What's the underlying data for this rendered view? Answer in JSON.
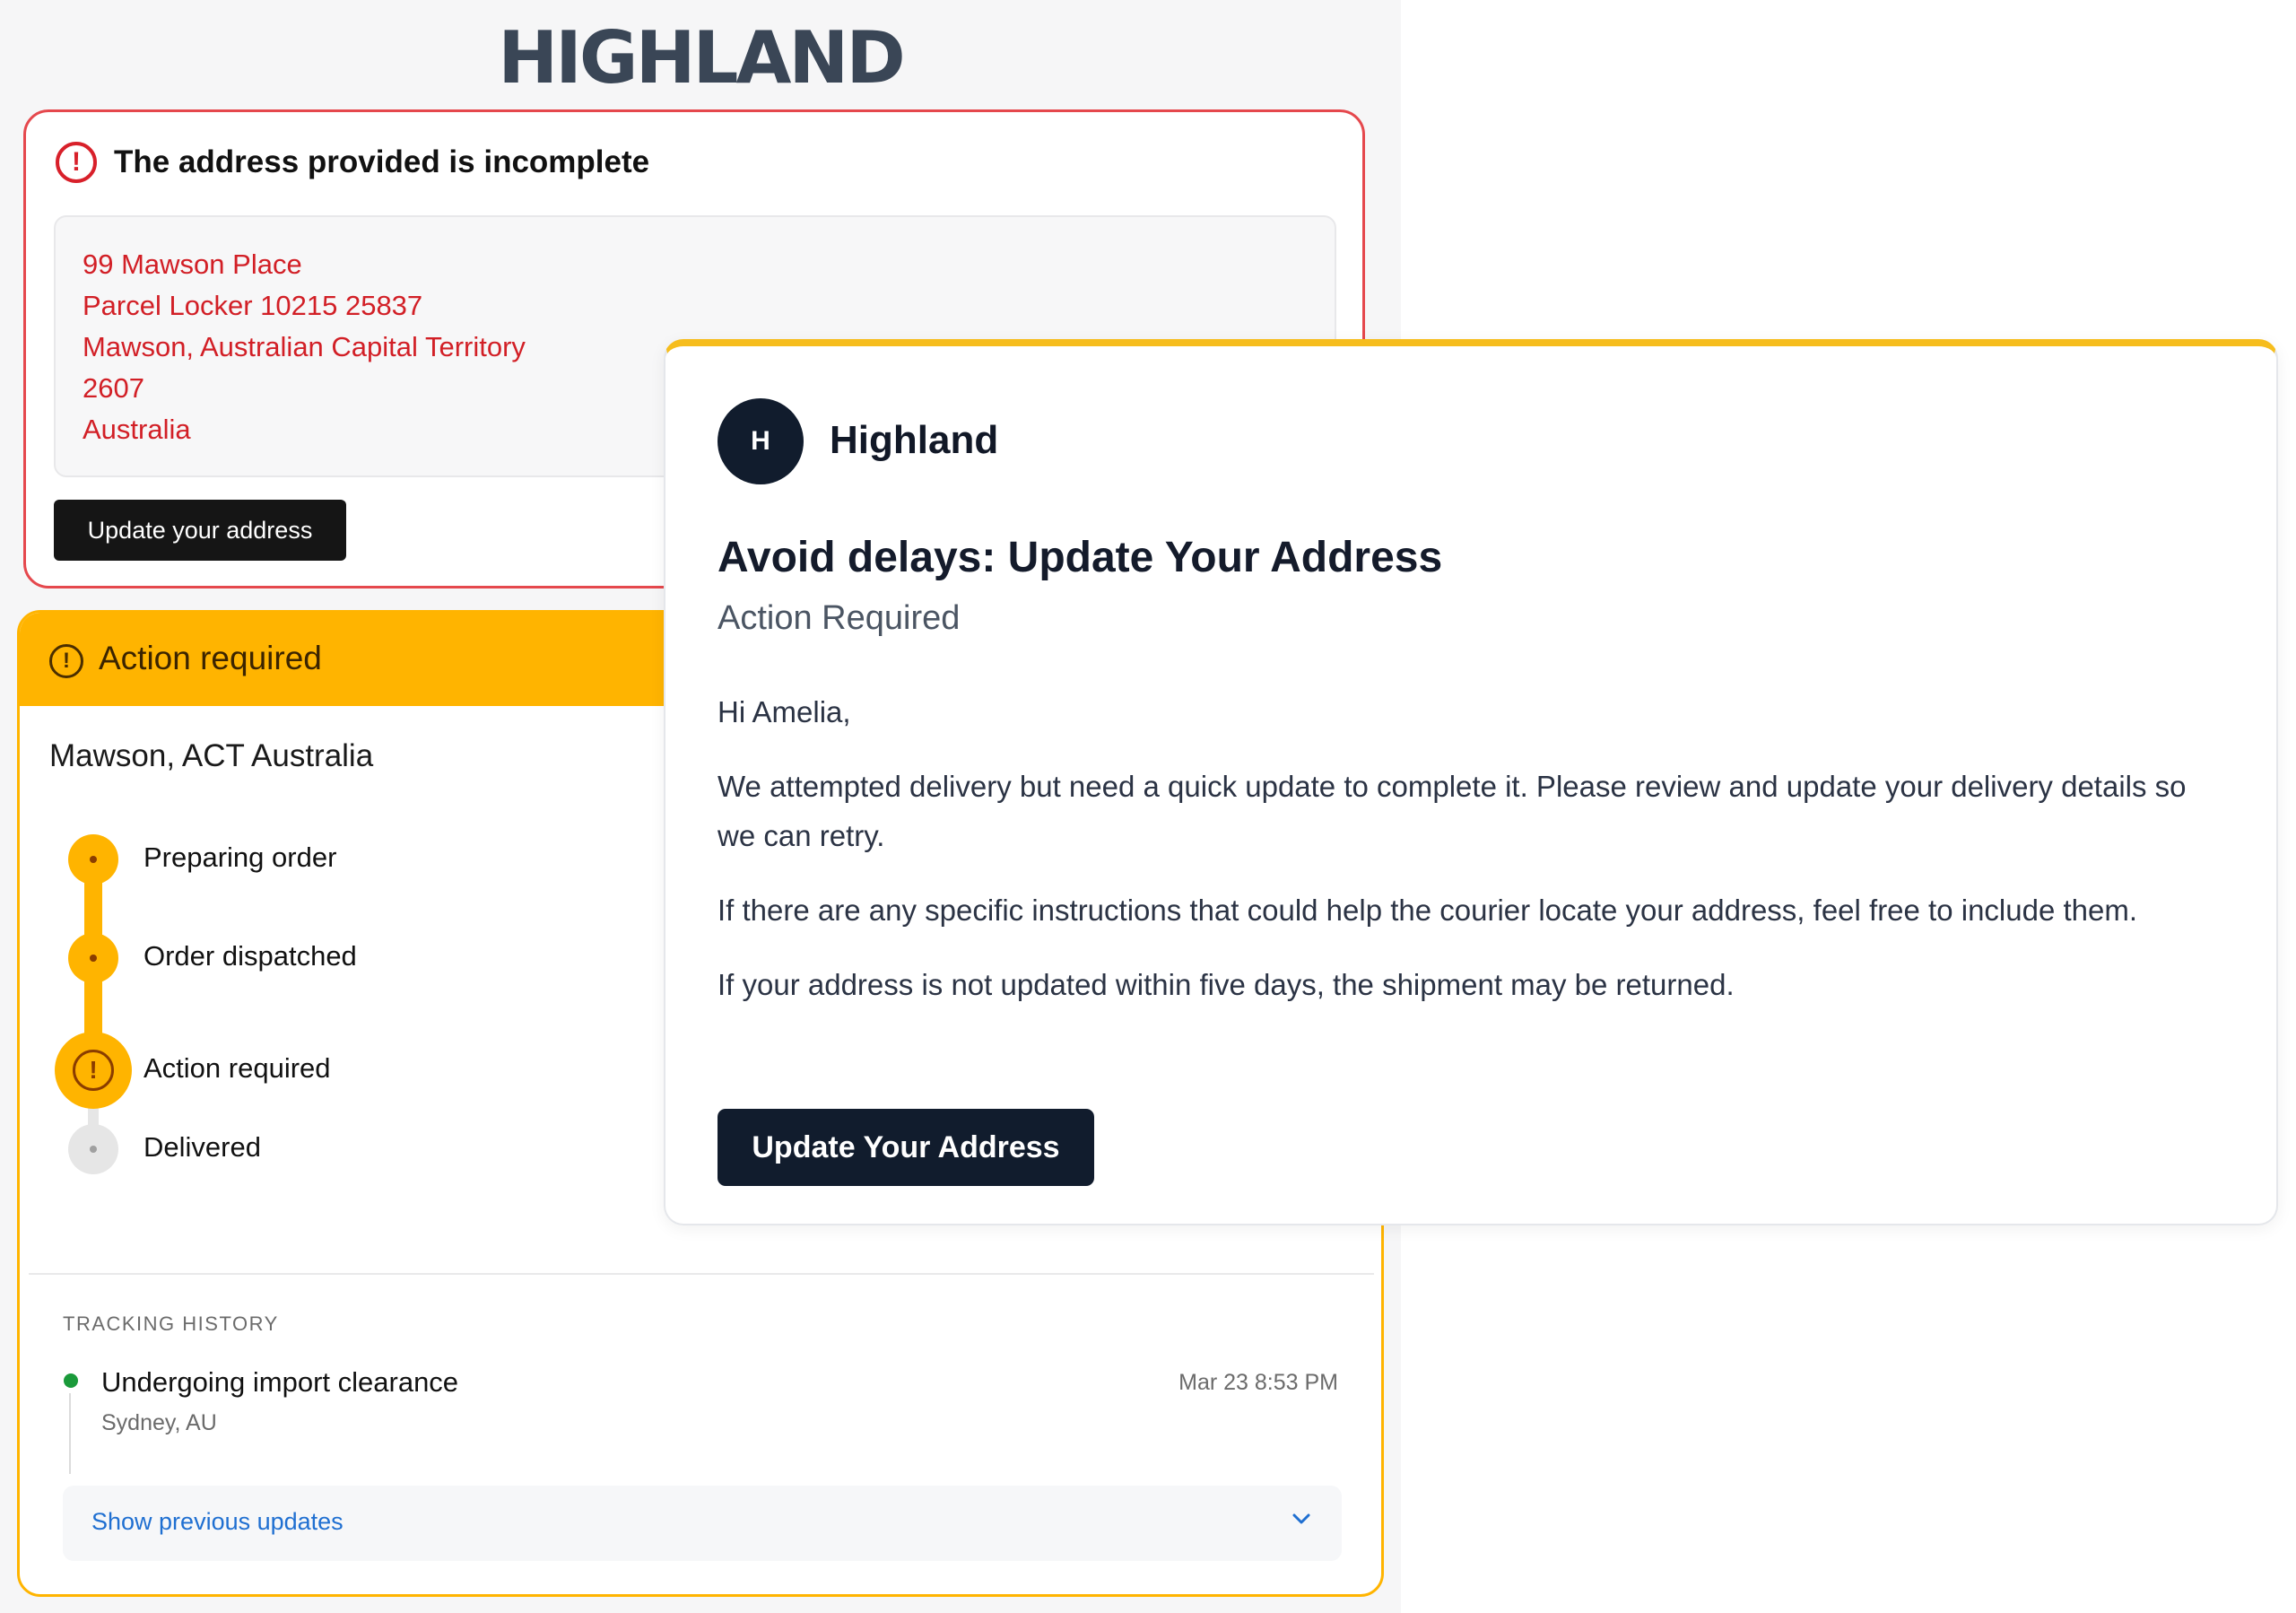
{
  "brand": {
    "logo": "HIGHLAND"
  },
  "error_card": {
    "title": "The address provided is incomplete",
    "address_lines": [
      "99 Mawson Place",
      "Parcel Locker 10215 25837",
      "Mawson, Australian Capital Territory",
      "2607",
      "Australia"
    ],
    "button": "Update your address"
  },
  "tracking": {
    "header": "Action required",
    "location": "Mawson, ACT Australia",
    "steps": [
      {
        "label": "Preparing order",
        "state": "done"
      },
      {
        "label": "Order dispatched",
        "state": "done"
      },
      {
        "label": "Action required",
        "state": "current"
      },
      {
        "label": "Delivered",
        "state": "pending"
      }
    ],
    "history_title": "TRACKING HISTORY",
    "history": [
      {
        "event": "Undergoing import clearance",
        "place": "Sydney, AU",
        "time": "Mar 23 8:53 PM"
      }
    ],
    "show_previous": "Show previous updates"
  },
  "email": {
    "avatar_letter": "H",
    "sender": "Highland",
    "title": "Avoid delays: Update Your Address",
    "subtitle": "Action Required",
    "greeting": "Hi Amelia,",
    "paragraphs": [
      "We attempted delivery but need a quick update to complete it. Please review and update your delivery details so we can retry.",
      "If there are any specific instructions that could help the courier locate your address, feel free to include them.",
      "If your address is not updated within five days, the shipment may be returned."
    ],
    "button": "Update Your Address"
  },
  "colors": {
    "error_red": "#d21f26",
    "warning_yellow": "#ffb400",
    "dark_navy": "#111c2d",
    "success_green": "#1a9a3a",
    "link_blue": "#1f6fd1"
  },
  "icons": {
    "error": "alert-circle-icon",
    "warning": "alert-circle-icon",
    "expand": "chevron-down-icon"
  }
}
